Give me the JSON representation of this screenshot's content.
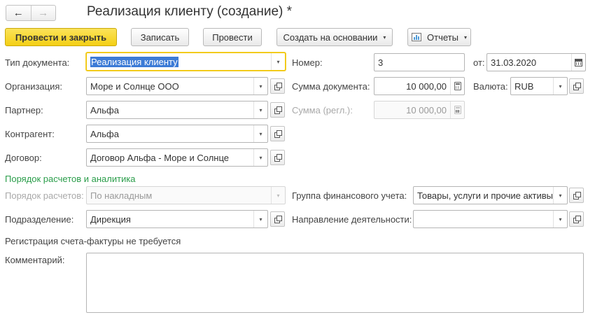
{
  "window": {
    "title": "Реализация клиенту (создание) *",
    "nav_back": "←",
    "nav_forward": "→"
  },
  "toolbar": {
    "post_close": "Провести и закрыть",
    "save": "Записать",
    "post": "Провести",
    "create_based": "Создать на основании",
    "reports": "Отчеты",
    "dropdown_glyph": "▾"
  },
  "fields": {
    "doc_type": {
      "label": "Тип документа:",
      "value": "Реализация клиенту"
    },
    "number": {
      "label": "Номер:",
      "value": "3"
    },
    "date": {
      "label": "от:",
      "value": "31.03.2020"
    },
    "organization": {
      "label": "Организация:",
      "value": "Море и Солнце ООО"
    },
    "doc_sum": {
      "label": "Сумма документа:",
      "value": "10 000,00"
    },
    "currency": {
      "label": "Валюта:",
      "value": "RUB"
    },
    "partner": {
      "label": "Партнер:",
      "value": "Альфа"
    },
    "sum_regl": {
      "label": "Сумма (регл.):",
      "value": "10 000,00"
    },
    "counterparty": {
      "label": "Контрагент:",
      "value": "Альфа"
    },
    "contract": {
      "label": "Договор:",
      "value": "Договор Альфа - Море и Солнце"
    },
    "settlement_order": {
      "label": "Порядок расчетов:",
      "value": "По накладным"
    },
    "fin_group": {
      "label": "Группа финансового учета:",
      "value": "Товары, услуги и прочие активы"
    },
    "department": {
      "label": "Подразделение:",
      "value": "Дирекция"
    },
    "activity": {
      "label": "Направление деятельности:",
      "value": ""
    },
    "comment": {
      "label": "Комментарий:",
      "value": ""
    }
  },
  "section_settlements": "Порядок расчетов и аналитика",
  "invoice_note": "Регистрация счета-фактуры не требуется",
  "icons": {
    "dropdown": "chevron-down-icon",
    "open": "open-form-icon",
    "calculator": "calculator-icon",
    "calendar": "calendar-icon",
    "report": "report-icon"
  },
  "colors": {
    "primary_button": "#f4cf15",
    "section_header": "#2a9d4a",
    "focus_border": "#f0c400",
    "selection": "#3c7bd6"
  }
}
